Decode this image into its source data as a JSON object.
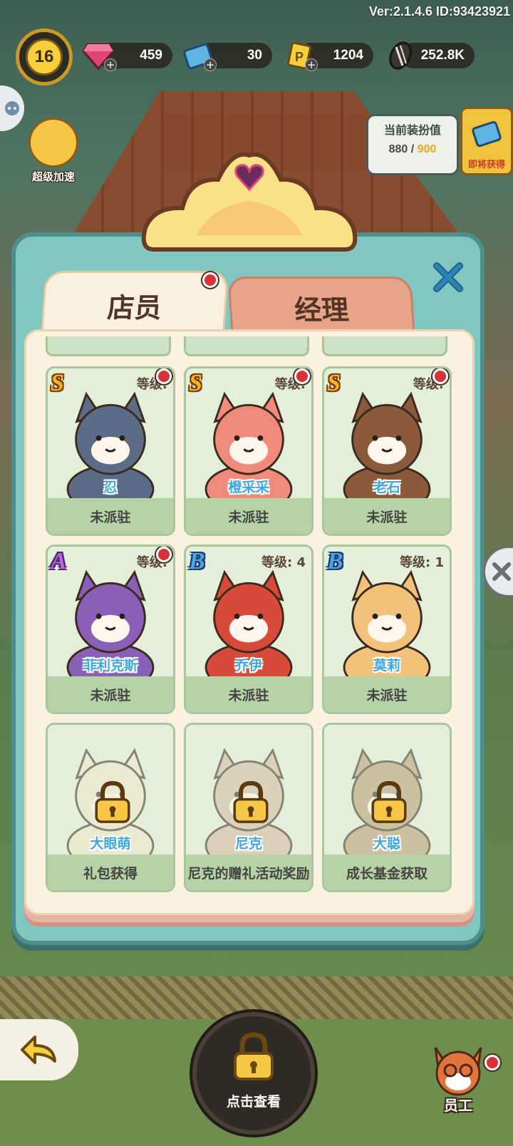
{
  "top_bar": {
    "version": "Ver:2.1.4.6 ID:93423921",
    "level": "16",
    "resources": [
      {
        "icon": "gem-icon",
        "value": "459"
      },
      {
        "icon": "ticket-icon",
        "value": "30"
      },
      {
        "icon": "coupon-icon",
        "value": "1204"
      },
      {
        "icon": "sunflower-seed-icon",
        "value": "252.8K"
      }
    ]
  },
  "side": {
    "boost_label": "超级加速",
    "deco_title": "当前装扮值",
    "deco_current": "880",
    "deco_sep": "/",
    "deco_max": "900",
    "deco_get_label": "即将获得"
  },
  "tabs": {
    "staff": "店员",
    "manager": "经理"
  },
  "cards": [
    {
      "rank": "S",
      "level_label": "等级:",
      "level_value": "",
      "name": "忍",
      "status": "未派驻",
      "new": true,
      "locked": false,
      "color": "#5d6c86"
    },
    {
      "rank": "S",
      "level_label": "等级:",
      "level_value": "",
      "name": "橙采采",
      "status": "未派驻",
      "new": true,
      "locked": false,
      "color": "#f08a7a"
    },
    {
      "rank": "S",
      "level_label": "等级:",
      "level_value": "",
      "name": "老石",
      "status": "未派驻",
      "new": true,
      "locked": false,
      "color": "#8a5a3a"
    },
    {
      "rank": "A",
      "level_label": "等级:",
      "level_value": "",
      "name": "菲利克斯",
      "status": "未派驻",
      "new": true,
      "locked": false,
      "color": "#8a5fb8"
    },
    {
      "rank": "B",
      "level_label": "等级:",
      "level_value": "4",
      "name": "乔伊",
      "status": "未派驻",
      "new": false,
      "locked": false,
      "color": "#d84a3a"
    },
    {
      "rank": "B",
      "level_label": "等级:",
      "level_value": "1",
      "name": "莫莉",
      "status": "未派驻",
      "new": false,
      "locked": false,
      "color": "#f2c27a"
    },
    {
      "rank": "",
      "level_label": "",
      "level_value": "",
      "name": "大眼萌",
      "status": "礼包获得",
      "new": false,
      "locked": true,
      "color": "#efe6c8"
    },
    {
      "rank": "",
      "level_label": "",
      "level_value": "",
      "name": "尼克",
      "status": "尼克的赠礼活动奖励",
      "new": false,
      "locked": true,
      "color": "#d8b8a0"
    },
    {
      "rank": "",
      "level_label": "",
      "level_value": "",
      "name": "大聪",
      "status": "成长基金获取",
      "new": false,
      "locked": true,
      "color": "#b89a70"
    }
  ],
  "bottom": {
    "center_label": "点击查看",
    "staff_label": "员工"
  }
}
